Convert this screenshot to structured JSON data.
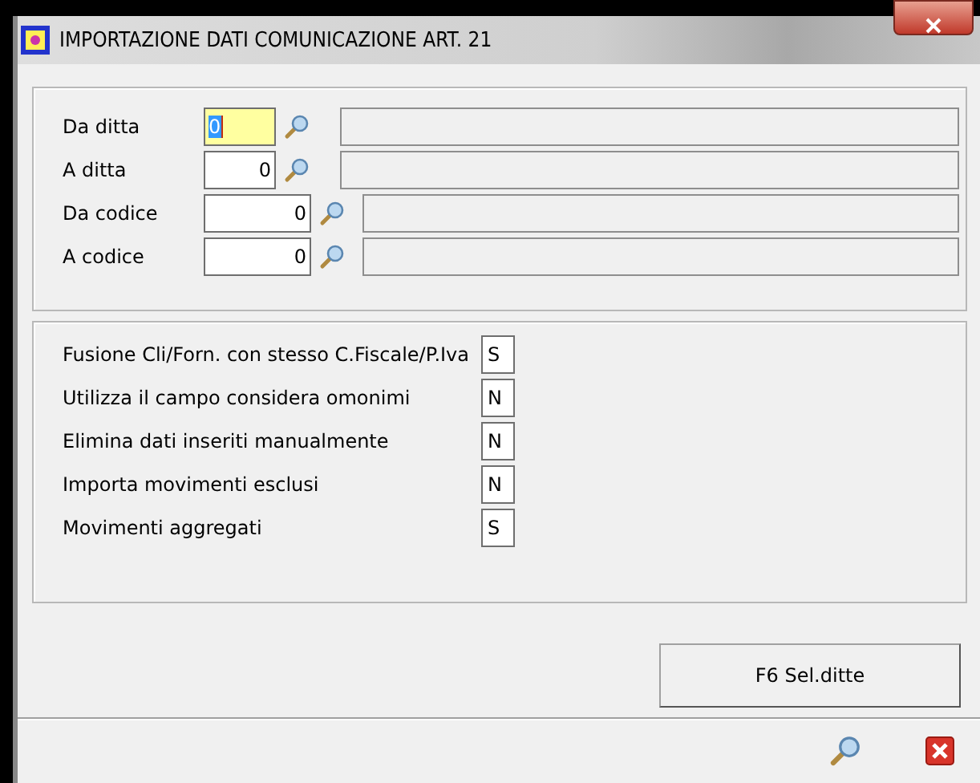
{
  "window": {
    "title": "IMPORTAZIONE DATI COMUNICAZIONE ART. 21"
  },
  "range_fields": [
    {
      "label": "Da ditta",
      "value": "0",
      "focused": true,
      "wide": false
    },
    {
      "label": "A ditta",
      "value": "0",
      "focused": false,
      "wide": false
    },
    {
      "label": "Da codice",
      "value": "0",
      "focused": false,
      "wide": true
    },
    {
      "label": "A codice",
      "value": "0",
      "focused": false,
      "wide": true
    }
  ],
  "options": [
    {
      "label": "Fusione Cli/Forn. con stesso C.Fiscale/P.Iva",
      "value": "S"
    },
    {
      "label": "Utilizza il campo considera omonimi",
      "value": "N"
    },
    {
      "label": "Elimina dati inseriti manualmente",
      "value": "N"
    },
    {
      "label": "Importa movimenti esclusi",
      "value": "N"
    },
    {
      "label": "Movimenti aggregati",
      "value": "S"
    }
  ],
  "buttons": [
    {
      "label": "F6 Sel.ditte"
    }
  ]
}
